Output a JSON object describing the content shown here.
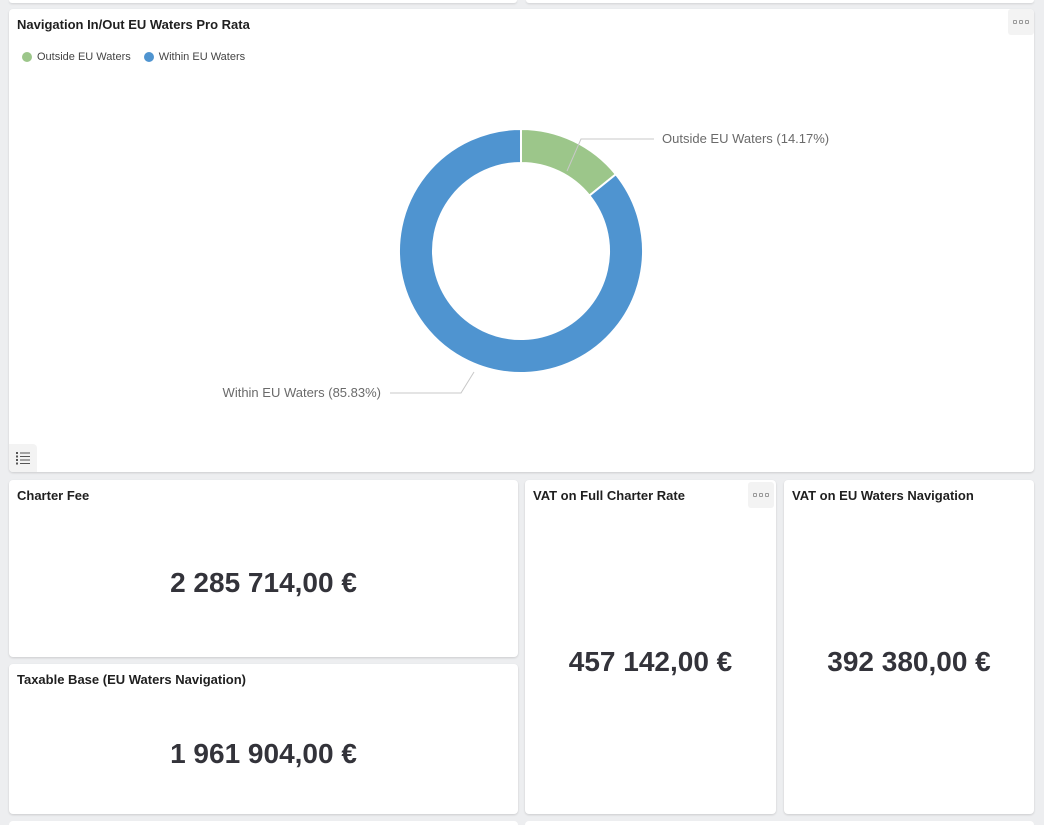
{
  "donut_card": {
    "title": "Navigation In/Out EU Waters Pro Rata",
    "legend": [
      {
        "label": "Outside EU Waters",
        "color": "#9cc68a"
      },
      {
        "label": "Within EU Waters",
        "color": "#4f94d0"
      }
    ]
  },
  "chart_data": {
    "type": "pie",
    "donut": true,
    "title": "Navigation In/Out EU Waters Pro Rata",
    "legend_position": "top-left",
    "slices": [
      {
        "name": "Outside EU Waters",
        "value": 14.17,
        "color": "#9cc68a",
        "label": "Outside EU Waters (14.17%)"
      },
      {
        "name": "Within EU Waters",
        "value": 85.83,
        "color": "#4f94d0",
        "label": "Within EU Waters (85.83%)"
      }
    ]
  },
  "kpis": {
    "charter_fee": {
      "title": "Charter Fee",
      "value": "2 285 714,00 €"
    },
    "vat_full": {
      "title": "VAT on Full Charter Rate",
      "value": "457 142,00 €"
    },
    "vat_eu": {
      "title": "VAT on EU Waters Navigation",
      "value": "392 380,00 €"
    },
    "taxable_base": {
      "title": "Taxable Base (EU Waters Navigation)",
      "value": "1 961 904,00 €"
    }
  },
  "icons": {
    "card_menu": "more-options-icon",
    "list": "list-icon"
  }
}
